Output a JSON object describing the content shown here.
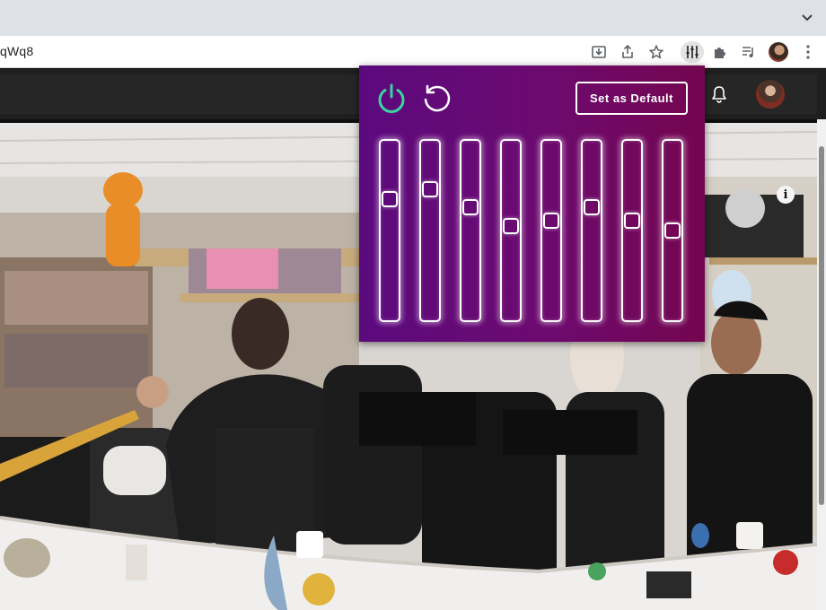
{
  "browser": {
    "omnibox_text": "qWq8",
    "icons": [
      "download-icon",
      "share-icon",
      "bookmark-star-icon",
      "equalizer-extension-icon",
      "extensions-puzzle-icon",
      "media-queue-icon",
      "profile-avatar",
      "menu-kebab-icon"
    ]
  },
  "popup": {
    "set_default_label": "Set as Default",
    "power_color": "#3dd3a0",
    "background": [
      "#5b0a7e",
      "#74064f"
    ],
    "sliders": [
      {
        "band": 1,
        "level": 0.7
      },
      {
        "band": 2,
        "level": 0.76
      },
      {
        "band": 3,
        "level": 0.65
      },
      {
        "band": 4,
        "level": 0.53
      },
      {
        "band": 5,
        "level": 0.56
      },
      {
        "band": 6,
        "level": 0.65
      },
      {
        "band": 7,
        "level": 0.56
      },
      {
        "band": 8,
        "level": 0.5
      }
    ]
  },
  "video": {
    "info_label": "i"
  }
}
